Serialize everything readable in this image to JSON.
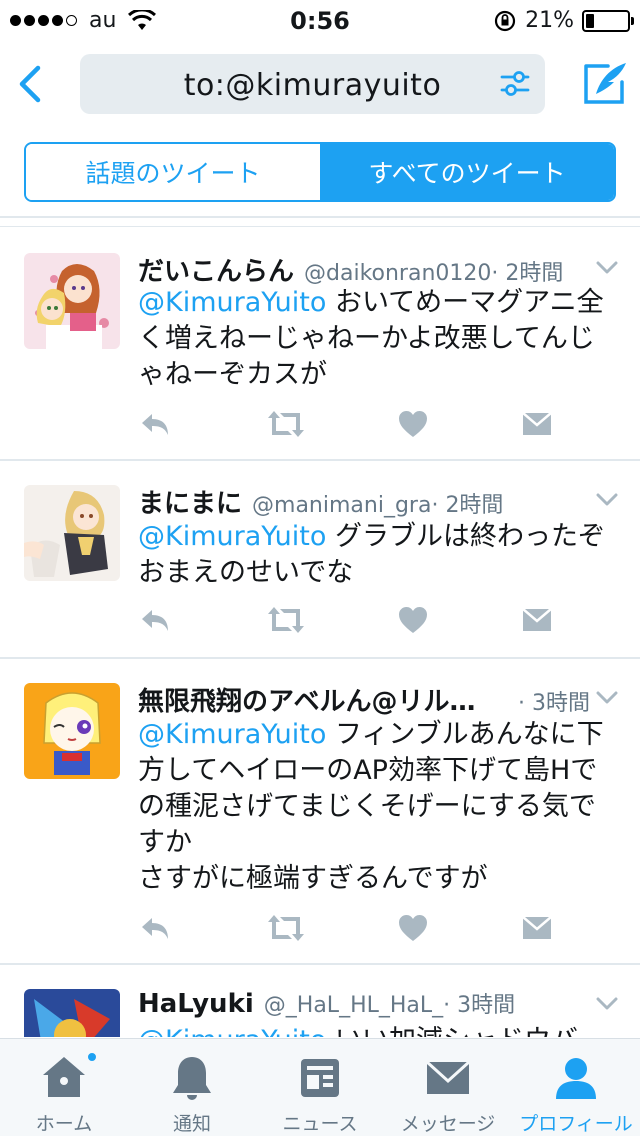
{
  "status_bar": {
    "carrier": "au",
    "time": "0:56",
    "battery_text": "21%",
    "battery_fraction": 0.21,
    "signal_dots_filled": 4,
    "signal_dots_total": 5
  },
  "nav": {
    "search_query": "to:@kimurayuito"
  },
  "segments": {
    "top_label": "話題のツイート",
    "all_label": "すべてのツイート",
    "selected": "all"
  },
  "tweets": [
    {
      "name": "だいこんらん",
      "handle": "@daikonran0120",
      "time": "· 2時間",
      "mention": "@KimuraYuito",
      "text": " おいてめーマグアニ全く増えねーじゃねーかよ改悪してんじゃねーぞカスが"
    },
    {
      "name": "まにまに",
      "handle": "@manimani_gra",
      "time": "· 2時間",
      "mention": "@KimuraYuito",
      "text": " グラブルは終わったぞおまえのせいでな"
    },
    {
      "name": "無限飛翔のアベルん@リル頑…",
      "handle": "",
      "time": "· 3時間",
      "mention": "@KimuraYuito",
      "text": " フィンブルあんなに下方してヘイローのAP効率下げて島Hでの種泥さげてまじくそげーにする気ですか",
      "text2": "さすがに極端すぎるんですが"
    },
    {
      "name": "HaLyuki",
      "handle": "@_HaL_HL_HaL_",
      "time": "· 3時間",
      "mention": "@KimuraYuito",
      "text": " いい加減シャドウバー"
    }
  ],
  "tab_bar": {
    "home": "ホーム",
    "notifications": "通知",
    "news": "ニュース",
    "messages": "メッセージ",
    "profile": "プロフィール",
    "active": "profile"
  },
  "colors": {
    "accent": "#1da1f2",
    "icon_gray": "#aab8c2",
    "text_gray": "#657786"
  }
}
